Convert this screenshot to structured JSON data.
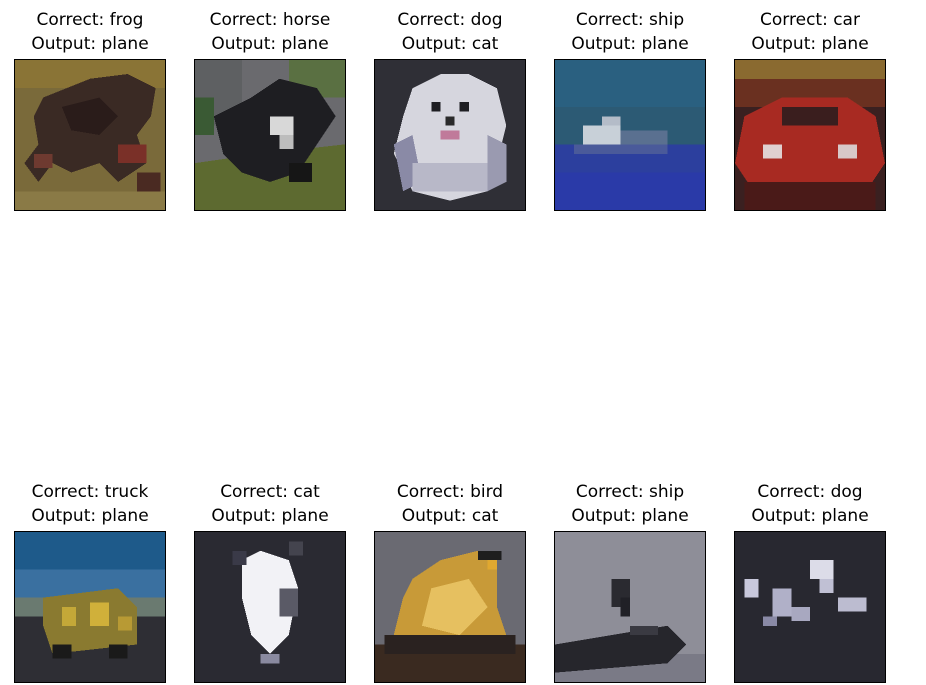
{
  "panels": [
    {
      "correct": "Correct: frog",
      "output": "Output: plane",
      "scene": "frog"
    },
    {
      "correct": "Correct: horse",
      "output": "Output: plane",
      "scene": "horse"
    },
    {
      "correct": "Correct: dog",
      "output": "Output: cat",
      "scene": "dog-white"
    },
    {
      "correct": "Correct: ship",
      "output": "Output: plane",
      "scene": "ship-sea"
    },
    {
      "correct": "Correct: car",
      "output": "Output: plane",
      "scene": "car-red"
    },
    {
      "correct": "Correct: truck",
      "output": "Output: plane",
      "scene": "truck"
    },
    {
      "correct": "Correct: cat",
      "output": "Output: plane",
      "scene": "cat-dark"
    },
    {
      "correct": "Correct: bird",
      "output": "Output: cat",
      "scene": "bird-yellow"
    },
    {
      "correct": "Correct: ship",
      "output": "Output: plane",
      "scene": "ship-grey"
    },
    {
      "correct": "Correct: dog",
      "output": "Output: plane",
      "scene": "dog-dark"
    }
  ]
}
